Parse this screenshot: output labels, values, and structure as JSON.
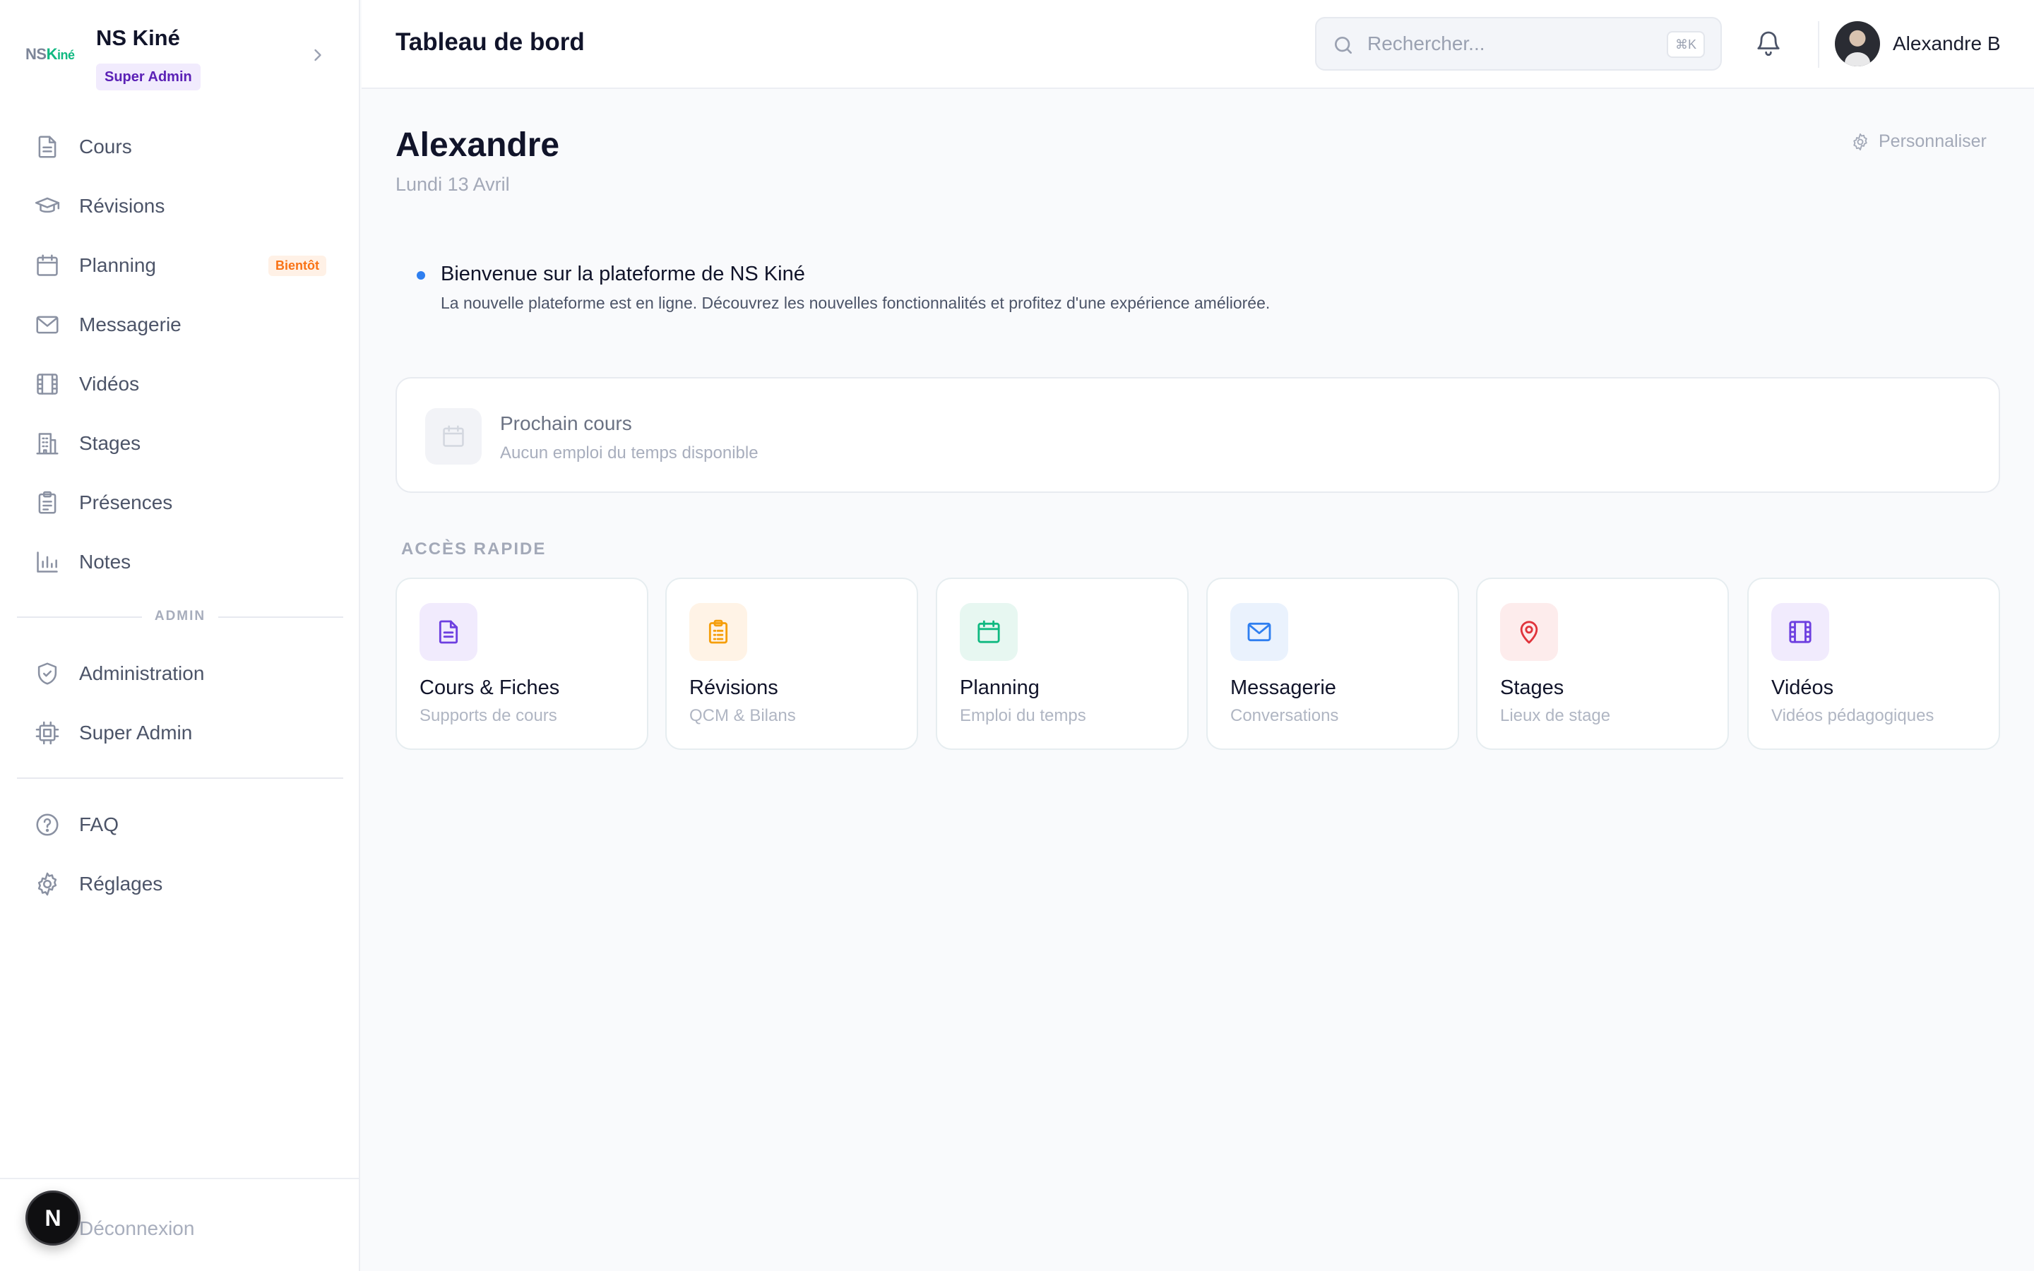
{
  "brand": {
    "logo_ns": "NS",
    "logo_k": "K",
    "logo_ine": "iné",
    "name": "NS Kiné",
    "role_badge": "Super Admin"
  },
  "sidebar": {
    "items": [
      {
        "label": "Cours",
        "icon": "document-icon"
      },
      {
        "label": "Révisions",
        "icon": "graduation-cap-icon"
      },
      {
        "label": "Planning",
        "icon": "calendar-icon",
        "badge": "Bientôt"
      },
      {
        "label": "Messagerie",
        "icon": "mail-icon"
      },
      {
        "label": "Vidéos",
        "icon": "film-icon"
      },
      {
        "label": "Stages",
        "icon": "building-icon"
      },
      {
        "label": "Présences",
        "icon": "clipboard-icon"
      },
      {
        "label": "Notes",
        "icon": "bar-chart-icon"
      }
    ],
    "admin_section_label": "ADMIN",
    "admin_items": [
      {
        "label": "Administration",
        "icon": "shield-icon"
      },
      {
        "label": "Super Admin",
        "icon": "chip-icon"
      }
    ],
    "bottom_items": [
      {
        "label": "FAQ",
        "icon": "help-circle-icon"
      },
      {
        "label": "Réglages",
        "icon": "gear-icon"
      }
    ],
    "logout_label": "Déconnexion",
    "dev_badge": "N"
  },
  "header": {
    "title": "Tableau de bord",
    "search_placeholder": "Rechercher...",
    "search_shortcut": "⌘K",
    "user_name": "Alexandre B"
  },
  "main": {
    "greeting": "Alexandre",
    "date": "Lundi 13 Avril",
    "customize_label": "Personnaliser",
    "announcement": {
      "title": "Bienvenue sur la plateforme de NS Kiné",
      "text": "La nouvelle plateforme est en ligne. Découvrez les nouvelles fonctionnalités et profitez d'une expérience améliorée."
    },
    "next_course": {
      "title": "Prochain cours",
      "subtitle": "Aucun emploi du temps disponible"
    },
    "quick_access_label": "ACCÈS RAPIDE",
    "quick_access": [
      {
        "title": "Cours & Fiches",
        "subtitle": "Supports de cours",
        "icon": "document-icon",
        "color": "#6d3fe0",
        "bg": "#f1ebfd"
      },
      {
        "title": "Révisions",
        "subtitle": "QCM & Bilans",
        "icon": "clipboard-icon",
        "color": "#f59e0b",
        "bg": "#fff3e6"
      },
      {
        "title": "Planning",
        "subtitle": "Emploi du temps",
        "icon": "calendar-icon",
        "color": "#10b981",
        "bg": "#e7f7f1"
      },
      {
        "title": "Messagerie",
        "subtitle": "Conversations",
        "icon": "mail-icon",
        "color": "#2f7ff0",
        "bg": "#eaf2fd"
      },
      {
        "title": "Stages",
        "subtitle": "Lieux de stage",
        "icon": "map-pin-icon",
        "color": "#e0343c",
        "bg": "#fdecec"
      },
      {
        "title": "Vidéos",
        "subtitle": "Vidéos pédagogiques",
        "icon": "film-icon",
        "color": "#6d3fe0",
        "bg": "#f1ebfd"
      }
    ]
  }
}
